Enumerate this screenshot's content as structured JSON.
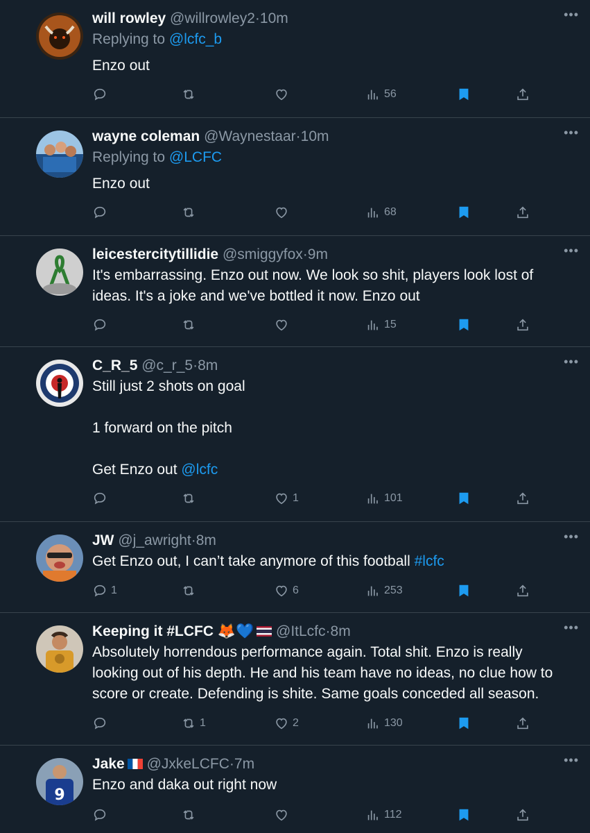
{
  "colors": {
    "background": "#15202b",
    "link": "#1d9bf0",
    "muted": "#8b98a5",
    "bookmark": "#1d9bf0"
  },
  "icons": {
    "reply": "reply-icon",
    "retweet": "retweet-icon",
    "like": "heart-icon",
    "views": "views-icon",
    "bookmark": "bookmark-filled-icon",
    "share": "share-icon",
    "more": "more-icon"
  },
  "tweets": [
    {
      "name": "will rowley",
      "handle": "@willrowley2",
      "dot": "·",
      "time": "10m",
      "replying_prefix": "Replying to ",
      "replying_to": "@lcfc_b",
      "text": "Enzo out",
      "replies": "",
      "retweets": "",
      "likes": "",
      "views": "56"
    },
    {
      "name": "wayne coleman",
      "handle": "@Waynestaar",
      "dot": "·",
      "time": "10m",
      "replying_prefix": "Replying to ",
      "replying_to": "@LCFC",
      "text": "Enzo out",
      "replies": "",
      "retweets": "",
      "likes": "",
      "views": "68"
    },
    {
      "name": "leicestercitytillidie",
      "handle": "@smiggyfox",
      "dot": "·",
      "time": "9m",
      "text": "It's embarrassing.  Enzo out now.  We look so shit, players look lost of ideas.  It's a joke and we've bottled it now.  Enzo out",
      "replies": "",
      "retweets": "",
      "likes": "",
      "views": "15"
    },
    {
      "name": "C_R_5",
      "handle": "@c_r_5",
      "dot": "·",
      "time": "8m",
      "text": "Still just 2 shots on goal\n\n1 forward on the pitch\n\nGet Enzo out ",
      "text_link": "@lcfc",
      "replies": "",
      "retweets": "",
      "likes": "1",
      "views": "101"
    },
    {
      "name": "JW",
      "handle": "@j_awright",
      "dot": "·",
      "time": "8m",
      "text": "Get Enzo out, I can’t take anymore of this football ",
      "text_link": "#lcfc",
      "replies": "1",
      "retweets": "",
      "likes": "6",
      "views": "253"
    },
    {
      "name": "Keeping it #LCFC",
      "name_emoji": "🦊💙",
      "handle": "@ItLcfc",
      "dot": "·",
      "time": "8m",
      "text": "Absolutely horrendous performance again. Total shit. Enzo is really looking out of his depth. He and his team have no ideas, no clue how to score or create. Defending is shite. Same goals conceded all season.",
      "replies": "",
      "retweets": "1",
      "likes": "2",
      "views": "130"
    },
    {
      "name": "Jake",
      "handle": "@JxkeLCFC",
      "dot": "·",
      "time": "7m",
      "text": "Enzo and daka out right now",
      "replies": "",
      "retweets": "",
      "likes": "",
      "views": "112"
    }
  ]
}
